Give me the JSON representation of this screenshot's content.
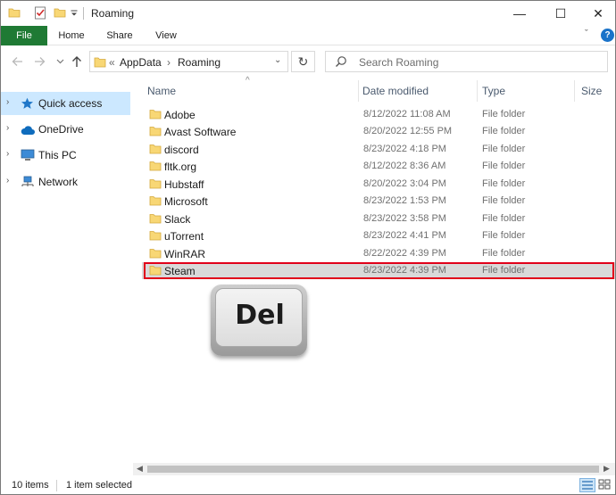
{
  "window": {
    "title": "Roaming",
    "minimize_glyph": "—",
    "maximize_glyph": "☐",
    "close_glyph": "✕"
  },
  "ribbon": {
    "tabs": [
      "File",
      "Home",
      "Share",
      "View"
    ],
    "collapse_glyph": "ˇ",
    "help_glyph": "?"
  },
  "address": {
    "prefix": "«",
    "segments": [
      "AppData",
      "Roaming"
    ],
    "separator": "›",
    "dropdown_glyph": "⌄",
    "refresh_glyph": "↻"
  },
  "search": {
    "placeholder": "Search Roaming"
  },
  "nav_pane": {
    "items": [
      {
        "label": "Quick access",
        "icon": "star-icon",
        "selected": true
      },
      {
        "label": "OneDrive",
        "icon": "cloud-icon",
        "selected": false
      },
      {
        "label": "This PC",
        "icon": "computer-icon",
        "selected": false
      },
      {
        "label": "Network",
        "icon": "network-icon",
        "selected": false
      }
    ]
  },
  "columns": {
    "name": "Name",
    "date": "Date modified",
    "type": "Type",
    "size": "Size"
  },
  "files": [
    {
      "name": "Adobe",
      "date": "8/12/2022 11:08 AM",
      "type": "File folder"
    },
    {
      "name": "Avast Software",
      "date": "8/20/2022 12:55 PM",
      "type": "File folder"
    },
    {
      "name": "discord",
      "date": "8/23/2022 4:18 PM",
      "type": "File folder"
    },
    {
      "name": "fltk.org",
      "date": "8/12/2022 8:36 AM",
      "type": "File folder"
    },
    {
      "name": "Hubstaff",
      "date": "8/20/2022 3:04 PM",
      "type": "File folder"
    },
    {
      "name": "Microsoft",
      "date": "8/23/2022 1:53 PM",
      "type": "File folder"
    },
    {
      "name": "Slack",
      "date": "8/23/2022 3:58 PM",
      "type": "File folder"
    },
    {
      "name": "uTorrent",
      "date": "8/23/2022 4:41 PM",
      "type": "File folder"
    },
    {
      "name": "WinRAR",
      "date": "8/22/2022 4:39 PM",
      "type": "File folder"
    },
    {
      "name": "Steam",
      "date": "8/23/2022 4:39 PM",
      "type": "File folder",
      "selected": true
    }
  ],
  "overlay": {
    "key_label": "Del"
  },
  "status": {
    "item_count": "10 items",
    "selection": "1 item selected"
  },
  "colors": {
    "file_tab": "#1f7a34",
    "selection_box": "#e1001a",
    "nav_selected": "#cce8ff",
    "folder_yellow": "#f8d775"
  }
}
